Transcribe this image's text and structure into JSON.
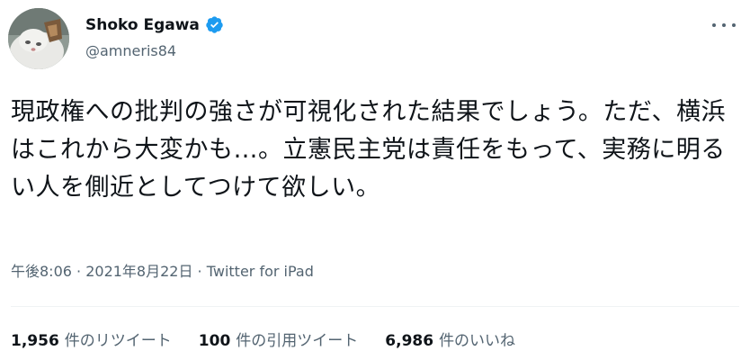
{
  "author": {
    "name": "Shoko Egawa",
    "handle": "@amneris84",
    "verified_color": "#1d9bf0"
  },
  "tweet": {
    "text": "現政権への批判の強さが可視化された結果でしょう。ただ、横浜はこれから大変かも…。立憲民主党は責任をもって、実務に明るい人を側近としてつけて欲しい。"
  },
  "meta": {
    "time": "午後8:06",
    "separator1": " · ",
    "date": "2021年8月22日",
    "separator2": " · ",
    "source": "Twitter for iPad"
  },
  "stats": {
    "retweets": {
      "count": "1,956",
      "label": "件のリツイート"
    },
    "quotes": {
      "count": "100",
      "label": "件の引用ツイート"
    },
    "likes": {
      "count": "6,986",
      "label": "件のいいね"
    }
  },
  "icons": {
    "more": "more-horizontal-icon",
    "verified": "verified-badge-icon"
  }
}
